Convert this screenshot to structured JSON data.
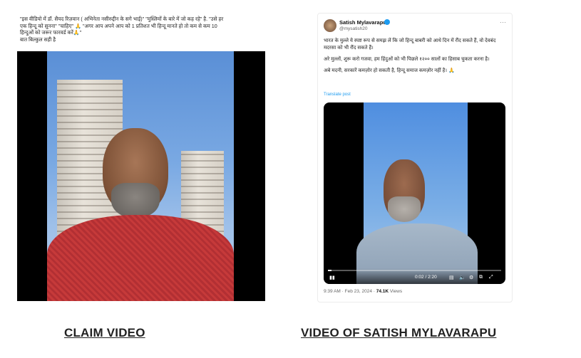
{
  "left": {
    "caption_lines": [
      "\"इस वीडियो में डॉ. सैयद रिज़वान ( अभिनेता  नसीरुद्दीन के सगे भाई)\" \"मुस्लिमों के बारे में जो कह रहे\" है. \"उसे हर",
      "एक हिन्दू को सुनना\" \"चाहिए\" 🙏 \"अगर आप अपने आप को 1 प्रतिशत भी हिन्दू मानते हो तो कम से कम 10",
      "हिन्दुओं को जरूर फारवर्ड करें🙏\"",
      "बात बिल्कुल सही है"
    ],
    "title": "CLAIM VIDEO"
  },
  "right": {
    "author_name": "Satish Mylavarapu",
    "author_handle": "@mysatish20",
    "paragraphs": [
      "भारत के मुल्ले ये स्पष्ट रूप से समझ लें कि जो हिन्दू बाबरी को आधे दिन में रौंद सकते हैं, वो देवबंद मदरसा को भी रौंद सकते हैं।",
      "अरे मुल्लों, शुरू करो गजवा, हम हिंदुओं को भी पिछले १२०० सालों का हिसाब चुकता करना है।",
      "अबे मदनी, सरकारें कमज़ोर हो सकती है, हिन्दू समाज कमज़ोर नहीं है। 🙏"
    ],
    "translate_label": "Translate post",
    "video_time": "0:02 / 2:20",
    "video_progress": 0.015,
    "meta_time": "9:39 AM · Feb 23, 2024 · ",
    "meta_views_count": "74.1K",
    "meta_views_label": " Views",
    "title": "VIDEO OF SATISH MYLAVARAPU"
  },
  "icons": {
    "play": "▮▮",
    "more": "···"
  }
}
